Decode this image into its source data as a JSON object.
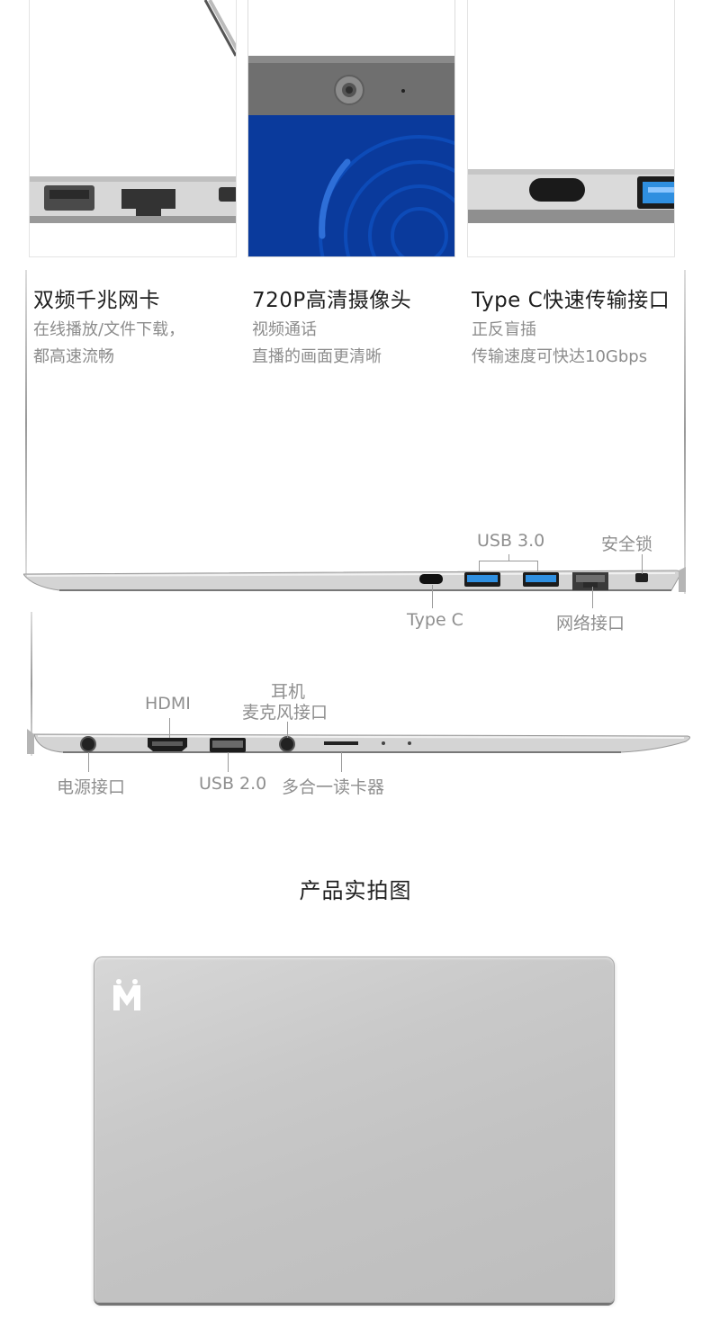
{
  "features": [
    {
      "title": "双频千兆网卡",
      "desc": [
        "在线播放/文件下载，",
        "都高速流畅"
      ]
    },
    {
      "title": "720P高清摄像头",
      "desc": [
        "视频通话",
        "直播的画面更清晰"
      ]
    },
    {
      "title": "Type C快速传输接口",
      "desc": [
        "正反盲插",
        "传输速度可快达10Gbps"
      ]
    }
  ],
  "ports_right": {
    "usb30": "USB 3.0",
    "lock": "安全锁",
    "typec": "Type C",
    "lan": "网络接口"
  },
  "ports_left": {
    "hdmi": "HDMI",
    "mic_line1": "耳机",
    "mic_line2": "麦克风接口",
    "power": "电源接口",
    "usb20": "USB 2.0",
    "card": "多合一读卡器"
  },
  "section": {
    "title": "产品实拍图"
  },
  "colors": {
    "camera_panel": "#0a3a9c",
    "usb_blue": "#2f8fe0",
    "label_gray": "#8f8f8f"
  }
}
